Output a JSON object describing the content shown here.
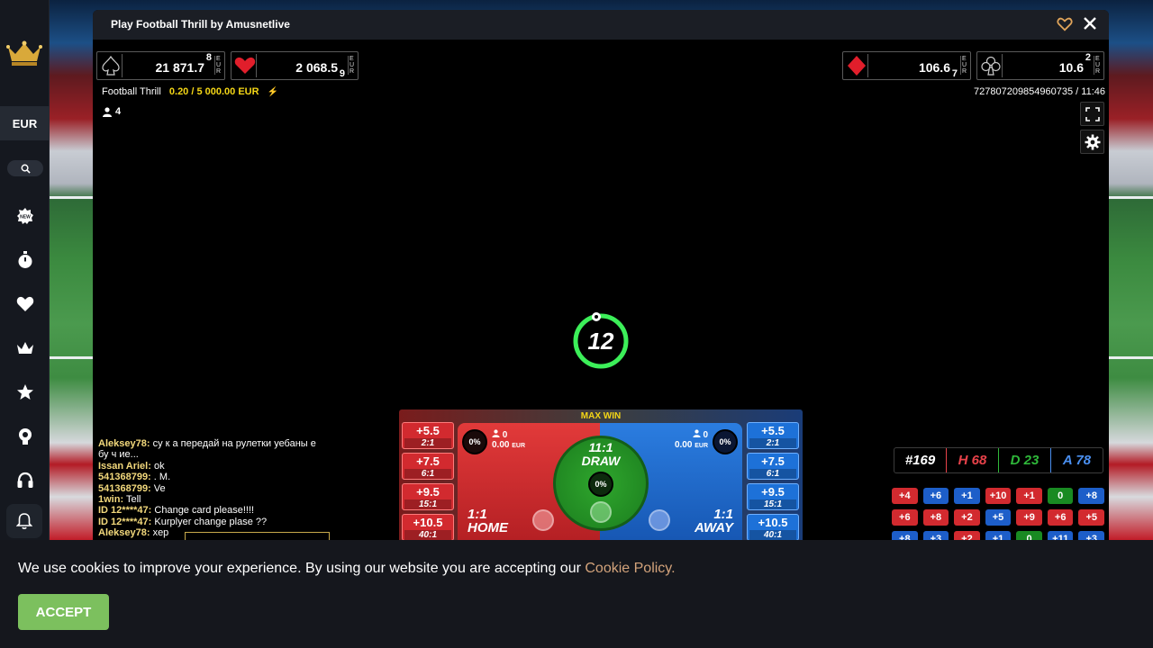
{
  "sidebar": {
    "currency": "EUR",
    "icons": [
      "new-games-icon",
      "timer-icon",
      "heart-icon",
      "crown-icon",
      "star-icon",
      "trophy-icon",
      "headset-icon",
      "bell-icon"
    ]
  },
  "window": {
    "title": "Play Football Thrill by Amusnetlive"
  },
  "jackpots": {
    "spade": {
      "value": "21 871.7",
      "sup": "8"
    },
    "heart": {
      "value": "2 068.5",
      "sup": "9"
    },
    "diamond": {
      "value": "106.6",
      "sup": "7"
    },
    "club": {
      "value": "10.6",
      "sup": "2"
    },
    "currency": "EUR"
  },
  "game": {
    "name": "Football Thrill",
    "limits": "0.20 / 5 000.00 EUR",
    "round_id": "727807209854960735 / 11:46",
    "players": "4",
    "timer": "12"
  },
  "chat": [
    {
      "user": "Aleksey78:",
      "text": "су к а передай на рулетки уебаны е бу ч ие..."
    },
    {
      "user": "Issan Ariel:",
      "text": "ok"
    },
    {
      "user": "541368799:",
      "text": ". M."
    },
    {
      "user": "541368799:",
      "text": "Ve"
    },
    {
      "user": "1win:",
      "text": "Tell"
    },
    {
      "user": "ID 12****47:",
      "text": "Change card please!!!!"
    },
    {
      "user": "ID 12****47:",
      "text": "Kurplyer change plase ??"
    },
    {
      "user": "Aleksey78:",
      "text": "xep"
    }
  ],
  "table": {
    "max_win": "MAX WIN",
    "home": {
      "odds": "1:1",
      "label": "HOME",
      "pct": "0%",
      "players": "0",
      "amount": "0.00",
      "currency": "EUR"
    },
    "away": {
      "odds": "1:1",
      "label": "AWAY",
      "pct": "0%",
      "players": "0",
      "amount": "0.00",
      "currency": "EUR"
    },
    "draw": {
      "odds": "11:1",
      "label": "DRAW",
      "pct": "0%"
    },
    "home_side": [
      {
        "total": "+5.5",
        "odds": "2:1"
      },
      {
        "total": "+7.5",
        "odds": "6:1"
      },
      {
        "total": "+9.5",
        "odds": "15:1"
      },
      {
        "total": "+10.5",
        "odds": "40:1"
      }
    ],
    "away_side": [
      {
        "total": "+5.5",
        "odds": "2:1"
      },
      {
        "total": "+7.5",
        "odds": "6:1"
      },
      {
        "total": "+9.5",
        "odds": "15:1"
      },
      {
        "total": "+10.5",
        "odds": "40:1"
      }
    ]
  },
  "stats": {
    "round": "#169",
    "home": "H 68",
    "draw": "D 23",
    "away": "A 78",
    "colors": {
      "home": "#e8424a",
      "draw": "#2fb83a",
      "away": "#4a8ff0"
    }
  },
  "history": [
    [
      {
        "v": "+4",
        "c": "r"
      },
      {
        "v": "+6",
        "c": "b"
      },
      {
        "v": "+1",
        "c": "b"
      },
      {
        "v": "+10",
        "c": "r"
      },
      {
        "v": "+1",
        "c": "r"
      },
      {
        "v": "0",
        "c": "g"
      },
      {
        "v": "+8",
        "c": "b"
      }
    ],
    [
      {
        "v": "+6",
        "c": "r"
      },
      {
        "v": "+8",
        "c": "r"
      },
      {
        "v": "+2",
        "c": "r"
      },
      {
        "v": "+5",
        "c": "b"
      },
      {
        "v": "+9",
        "c": "r"
      },
      {
        "v": "+6",
        "c": "r"
      },
      {
        "v": "+5",
        "c": "r"
      }
    ],
    [
      {
        "v": "+8",
        "c": "b"
      },
      {
        "v": "+3",
        "c": "b"
      },
      {
        "v": "+2",
        "c": "r"
      },
      {
        "v": "+1",
        "c": "b"
      },
      {
        "v": "0",
        "c": "g"
      },
      {
        "v": "+11",
        "c": "b"
      },
      {
        "v": "+3",
        "c": "b"
      }
    ]
  ],
  "cookie": {
    "text": "We use cookies to improve your experience. By using our website you are accepting our ",
    "link": "Cookie Policy.",
    "accept": "ACCEPT"
  }
}
